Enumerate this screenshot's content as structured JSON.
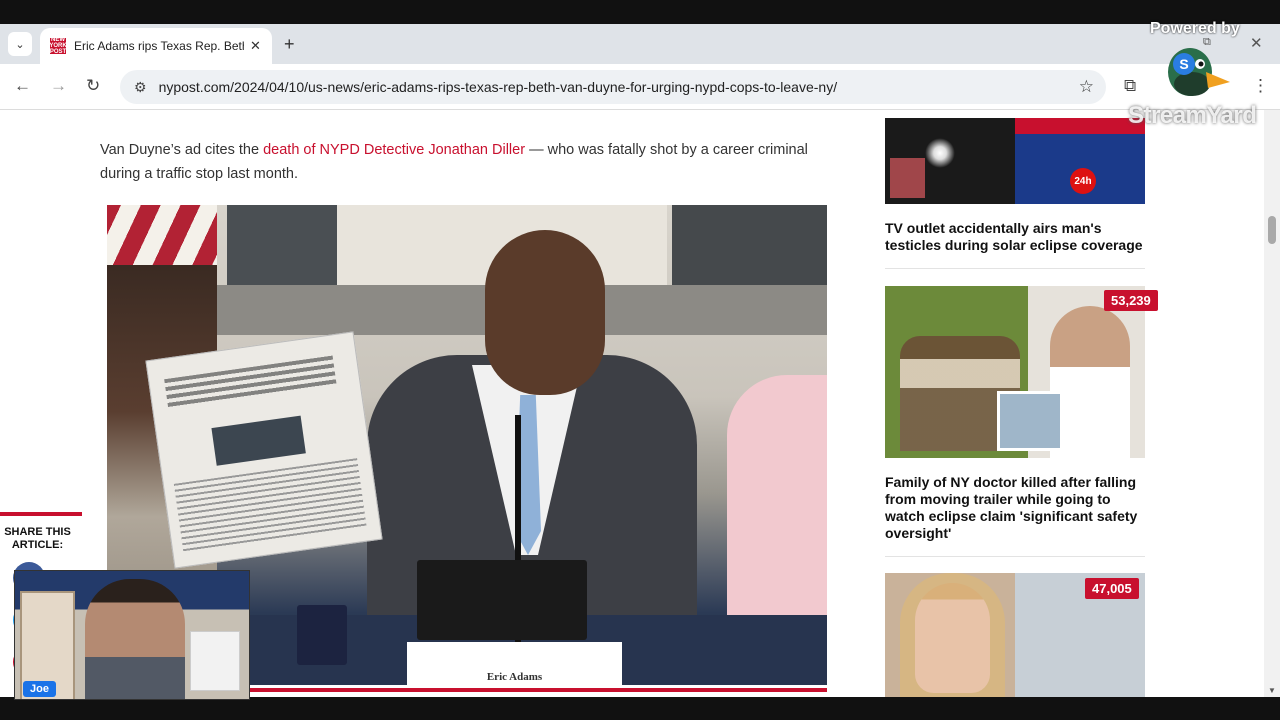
{
  "browser": {
    "tab": {
      "favicon_text": "NEW YORK POST",
      "title": "Eric Adams rips Texas Rep. Beth Van Duyne for urging NYPD cops to leave NY",
      "close_glyph": "✕"
    },
    "new_tab_glyph": "+",
    "tab_list_glyph": "⌄",
    "window_minimize_glyph": "⧉",
    "window_close_glyph": "✕",
    "back_glyph": "←",
    "forward_glyph": "→",
    "reload_glyph": "↻",
    "site_info_glyph": "⚙",
    "url": "nypost.com/2024/04/10/us-news/eric-adams-rips-texas-rep-beth-van-duyne-for-urging-nypd-cops-to-leave-ny/",
    "star_glyph": "☆",
    "extensions_glyph": "⧉",
    "menu_glyph": "⋮"
  },
  "article": {
    "paragraph_prefix": "Van Duyne’s ad cites the ",
    "paragraph_link": "death of NYPD Detective Jonathan Diller",
    "paragraph_suffix": " — who was fatally shot by a career criminal during a traffic stop last month.",
    "photo_nameplate": "Eric Adams",
    "accent_color": "#c8102e"
  },
  "share": {
    "label": "SHARE THIS ARTICLE:"
  },
  "sidebar": {
    "stories": [
      {
        "title": "TV outlet accidentally airs man's testicles during solar eclipse coverage",
        "image_logo": "24h"
      },
      {
        "title": "Family of NY doctor killed after falling from moving trailer while going to watch eclipse claim 'significant safety oversight'",
        "badge": "53,239"
      },
      {
        "badge": "47,005"
      }
    ]
  },
  "webcam": {
    "name": "Joe"
  },
  "watermark": {
    "powered_by": "Powered by",
    "brand": "StreamYard",
    "duck_letter": "S"
  },
  "scroll": {
    "down_arrow": "▼"
  }
}
